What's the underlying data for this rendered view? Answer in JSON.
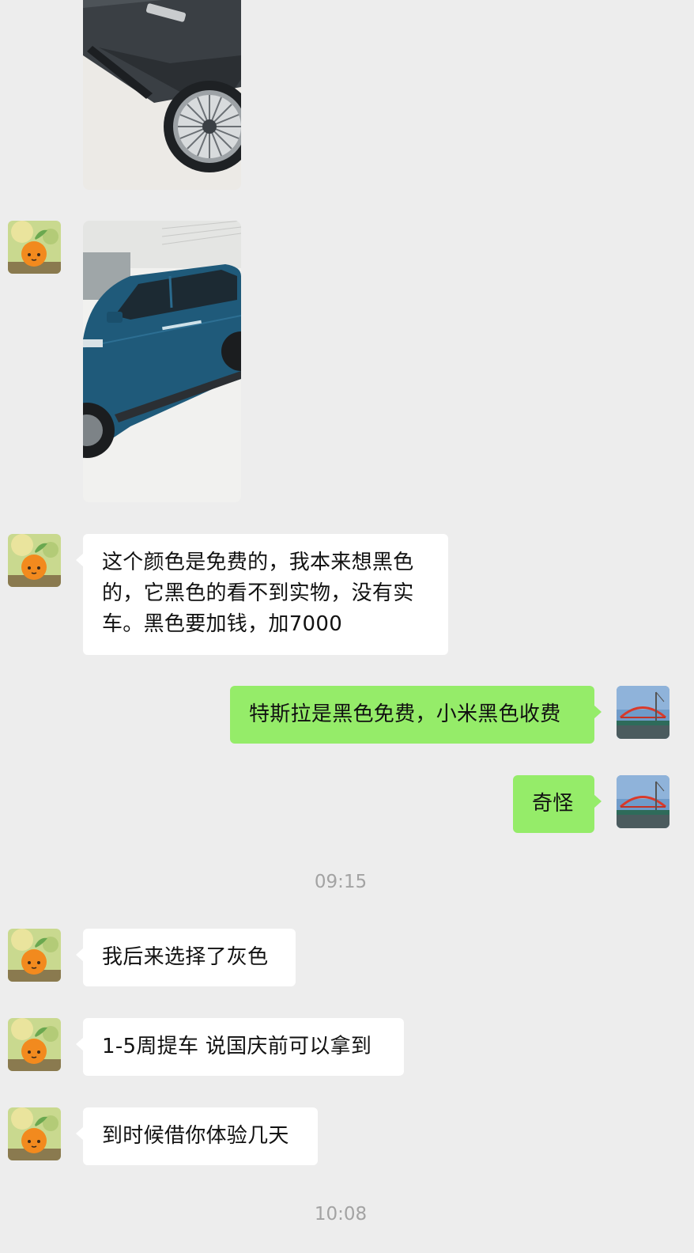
{
  "colors": {
    "background": "#ededed",
    "incoming_bubble": "#ffffff",
    "outgoing_bubble": "#95ec69",
    "timestamp_text": "#a3a3a3"
  },
  "messages": [
    {
      "type": "image",
      "from": "contact",
      "subject": "dark car side with multi-spoke wheel"
    },
    {
      "type": "image",
      "from": "contact",
      "subject": "blue SUV in showroom"
    },
    {
      "type": "text",
      "from": "contact",
      "lines": [
        "这个颜色是免费的，我本来想黑色",
        "的，它黑色的看不到实物，没有实",
        "车。黑色要加钱，加7000"
      ]
    },
    {
      "type": "text",
      "from": "me",
      "text": "特斯拉是黑色免费，小米黑色收费"
    },
    {
      "type": "text",
      "from": "me",
      "text": "奇怪"
    },
    {
      "type": "time",
      "text": "09:15"
    },
    {
      "type": "text",
      "from": "contact",
      "text": "我后来选择了灰色"
    },
    {
      "type": "text",
      "from": "contact",
      "text": "1-5周提车 说国庆前可以拿到"
    },
    {
      "type": "text",
      "from": "contact",
      "text": "到时候借你体验几天"
    },
    {
      "type": "time",
      "text": "10:08"
    }
  ],
  "avatars": {
    "contact": "orange-character-avatar",
    "me": "red-bridge-avatar"
  }
}
